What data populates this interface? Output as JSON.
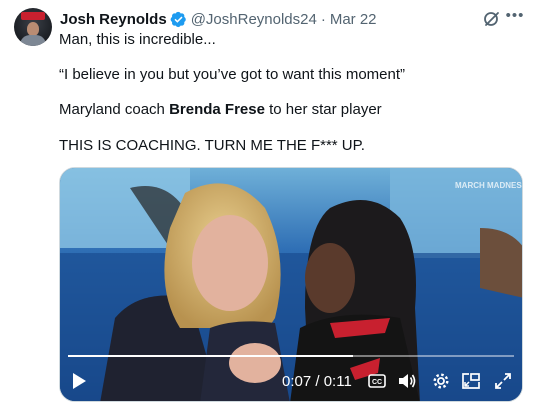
{
  "tweet": {
    "author_name": "Josh Reynolds",
    "handle": "@JoshReynolds24",
    "separator": "·",
    "date": "Mar 22",
    "line1": "Man, this is incredible...",
    "line2": "“I believe in you but you’ve got to want this moment”",
    "line3_prefix": "Maryland coach ",
    "line3_bold": "Brenda Frese",
    "line3_suffix": " to her star player",
    "line4": "THIS IS COACHING. TURN ME THE F*** UP."
  },
  "video": {
    "current_time": "0:07",
    "duration": "0:11",
    "progress": 0.64,
    "watermark": "MARCH MADNESS",
    "controls": {
      "play": "play-icon",
      "captions": "cc-icon",
      "volume": "volume-icon",
      "settings": "gear-icon",
      "pip": "pip-icon",
      "fullscreen": "fullscreen-icon"
    }
  },
  "colors": {
    "accent": "#1d9bf0",
    "text": "#0f1419",
    "muted": "#536471",
    "court_blue": "#1b4a8a"
  }
}
